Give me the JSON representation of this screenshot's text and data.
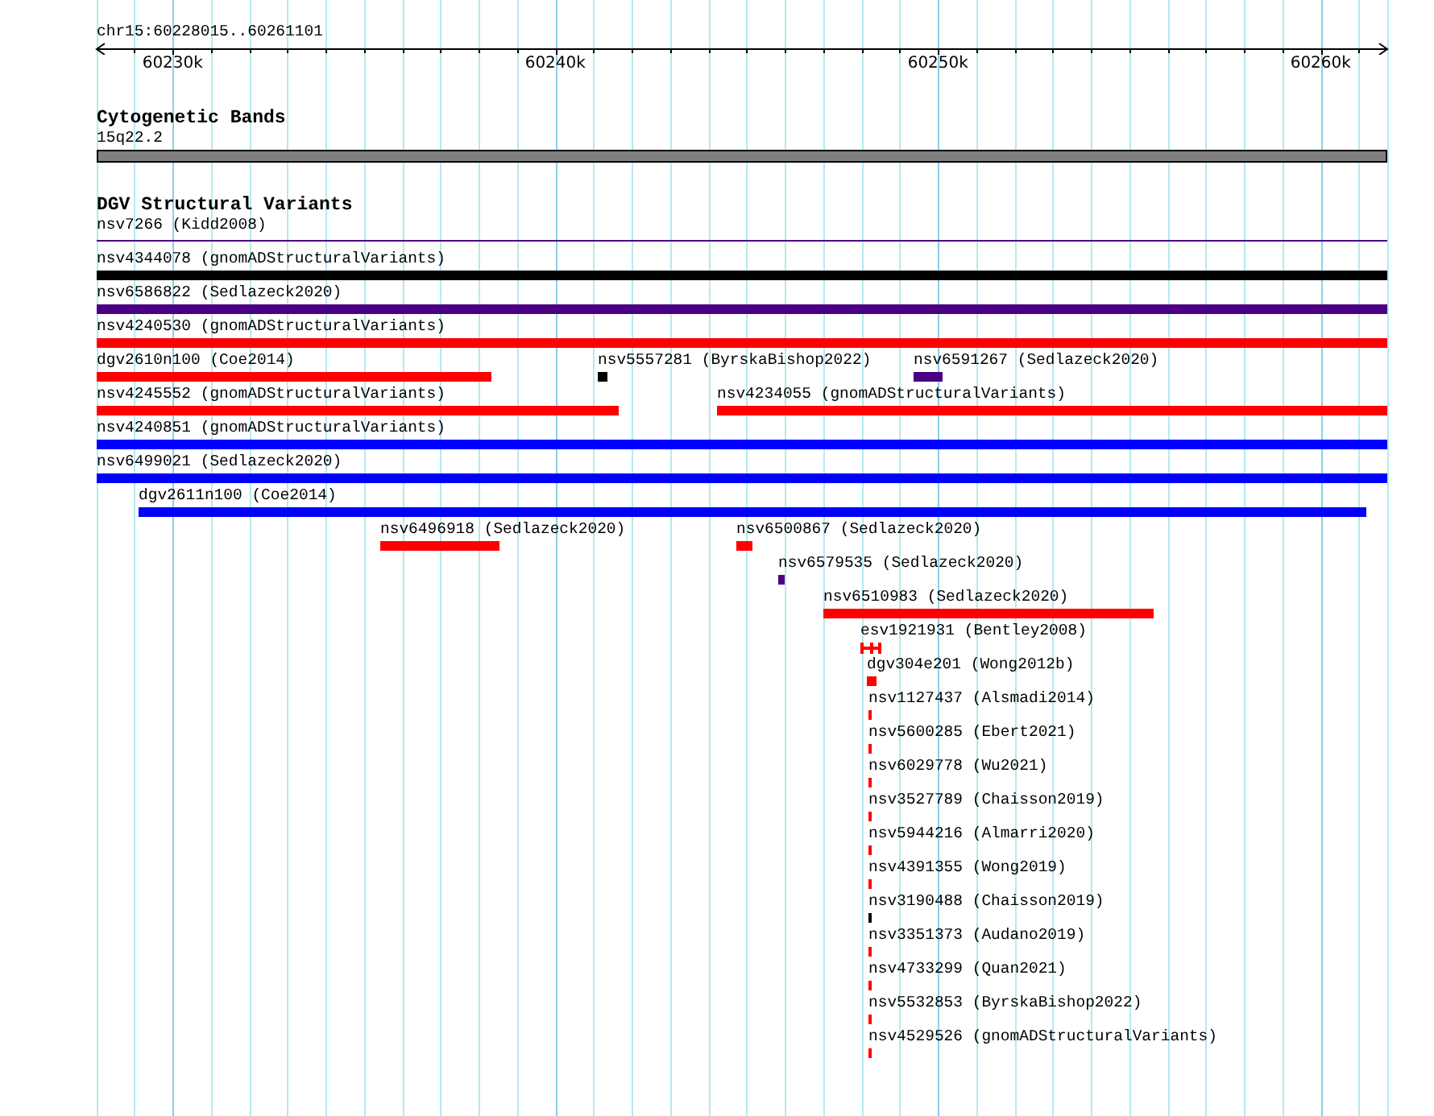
{
  "ruler": {
    "title": "chr15:60228015..60261101",
    "ticks": [
      {
        "label": "60230k"
      },
      {
        "label": "60240k"
      },
      {
        "label": "60250k"
      },
      {
        "label": "60260k"
      }
    ]
  },
  "tracks": [
    {
      "title": "Cytogenetic Bands",
      "rows": [
        [
          {
            "label": "15q22.2",
            "kind": "band",
            "color": "#808080"
          }
        ]
      ]
    },
    {
      "title": "DGV Structural Variants",
      "rows": [
        [
          {
            "label": "nsv7266 (Kidd2008)",
            "kind": "line",
            "color": "#4b0082"
          }
        ],
        [
          {
            "label": "nsv4344078 (gnomADStructuralVariants)",
            "kind": "bar",
            "color": "#000000"
          }
        ],
        [
          {
            "label": "nsv6586822 (Sedlazeck2020)",
            "kind": "bar",
            "color": "#4b0082"
          }
        ],
        [
          {
            "label": "nsv4240530 (gnomADStructuralVariants)",
            "kind": "bar",
            "color": "#ff0000"
          }
        ],
        [
          {
            "label": "dgv2610n100 (Coe2014)",
            "kind": "bar",
            "color": "#ff0000"
          },
          {
            "label": "nsv5557281 (ByrskaBishop2022)",
            "kind": "bar",
            "color": "#000000"
          },
          {
            "label": "nsv6591267 (Sedlazeck2020)",
            "kind": "bar",
            "color": "#4b0082"
          }
        ],
        [
          {
            "label": "nsv4245552 (gnomADStructuralVariants)",
            "kind": "bar",
            "color": "#ff0000"
          },
          {
            "label": "nsv4234055 (gnomADStructuralVariants)",
            "kind": "bar",
            "color": "#ff0000"
          }
        ],
        [
          {
            "label": "nsv4240851 (gnomADStructuralVariants)",
            "kind": "bar",
            "color": "#0000ff"
          }
        ],
        [
          {
            "label": "nsv6499021 (Sedlazeck2020)",
            "kind": "bar",
            "color": "#0000ff"
          }
        ],
        [
          {
            "label": "dgv2611n100 (Coe2014)",
            "kind": "bar",
            "color": "#0000ff"
          }
        ],
        [
          {
            "label": "nsv6496918 (Sedlazeck2020)",
            "kind": "bar",
            "color": "#ff0000"
          },
          {
            "label": "nsv6500867 (Sedlazeck2020)",
            "kind": "bar",
            "color": "#ff0000"
          }
        ],
        [
          {
            "label": "nsv6579535 (Sedlazeck2020)",
            "kind": "bar",
            "color": "#4b0082"
          }
        ],
        [
          {
            "label": "nsv6510983 (Sedlazeck2020)",
            "kind": "bar",
            "color": "#ff0000"
          }
        ],
        [
          {
            "label": "esv1921931 (Bentley2008)",
            "kind": "capped",
            "color": "#ff0000"
          }
        ],
        [
          {
            "label": "dgv304e201 (Wong2012b)",
            "kind": "bar",
            "color": "#ff0000"
          }
        ],
        [
          {
            "label": "nsv1127437 (Alsmadi2014)",
            "kind": "bar",
            "color": "#ff0000"
          }
        ],
        [
          {
            "label": "nsv5600285 (Ebert2021)",
            "kind": "bar",
            "color": "#ff0000"
          }
        ],
        [
          {
            "label": "nsv6029778 (Wu2021)",
            "kind": "bar",
            "color": "#ff0000"
          }
        ],
        [
          {
            "label": "nsv3527789 (Chaisson2019)",
            "kind": "bar",
            "color": "#ff0000"
          }
        ],
        [
          {
            "label": "nsv5944216 (Almarri2020)",
            "kind": "bar",
            "color": "#ff0000"
          }
        ],
        [
          {
            "label": "nsv4391355 (Wong2019)",
            "kind": "bar",
            "color": "#ff0000"
          }
        ],
        [
          {
            "label": "nsv3190488 (Chaisson2019)",
            "kind": "bar",
            "color": "#000000"
          }
        ],
        [
          {
            "label": "nsv3351373 (Audano2019)",
            "kind": "bar",
            "color": "#ff0000"
          }
        ],
        [
          {
            "label": "nsv4733299 (Quan2021)",
            "kind": "bar",
            "color": "#ff0000"
          }
        ],
        [
          {
            "label": "nsv5532853 (ByrskaBishop2022)",
            "kind": "bar",
            "color": "#ff0000"
          }
        ],
        [
          {
            "label": "nsv4529526 (gnomADStructuralVariants)",
            "kind": "bar",
            "color": "#ff0000"
          }
        ]
      ]
    }
  ]
}
